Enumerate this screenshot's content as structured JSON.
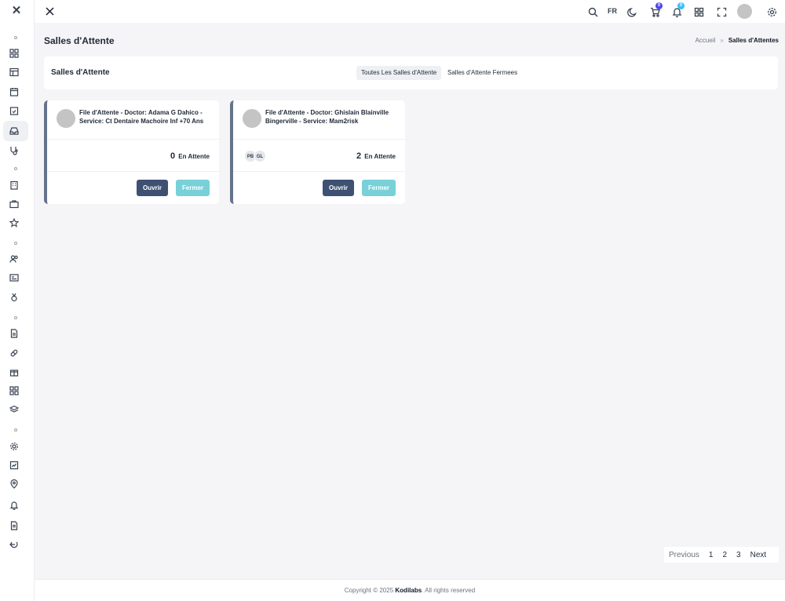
{
  "topbar": {
    "lang": "FR",
    "cart_badge": "0",
    "notif_badge": "0"
  },
  "page": {
    "title": "Salles d'Attente"
  },
  "breadcrumb": {
    "home": "Accueil",
    "separator": "»",
    "current": "Salles d'Attentes"
  },
  "header_card": {
    "title": "Salles d'Attente",
    "tabs": [
      {
        "label": "Toutes Les Salles d'Attente",
        "active": true
      },
      {
        "label": "Salles d'Attente Fermees",
        "active": false
      }
    ]
  },
  "queues": [
    {
      "name": "File d'Attente - Doctor: Adama G Dahico - Service: Ct Dentaire Machoire Inf +70 Ans",
      "count": "0",
      "count_label": "En Attente",
      "patients": [],
      "open_label": "Ouvrir",
      "close_label": "Fermer"
    },
    {
      "name": "File d'Attente - Doctor: Ghislain Blainville Bingerville - Service: Mam2risk",
      "count": "2",
      "count_label": "En Attente",
      "patients": [
        "PB",
        "GL"
      ],
      "open_label": "Ouvrir",
      "close_label": "Fermer"
    }
  ],
  "pagination": {
    "previous": "Previous",
    "pages": [
      "1",
      "2",
      "3"
    ],
    "next": "Next"
  },
  "footer": {
    "prefix": "Copyright © 2025",
    "brand": "Kodilabs",
    "suffix": ". All rights reserved"
  },
  "colors": {
    "open_button": "#3f5173",
    "close_button": "#79d0d8",
    "card_border": "#64748b",
    "cart_badge": "#4f46e5",
    "notif_badge": "#38bdf8"
  }
}
